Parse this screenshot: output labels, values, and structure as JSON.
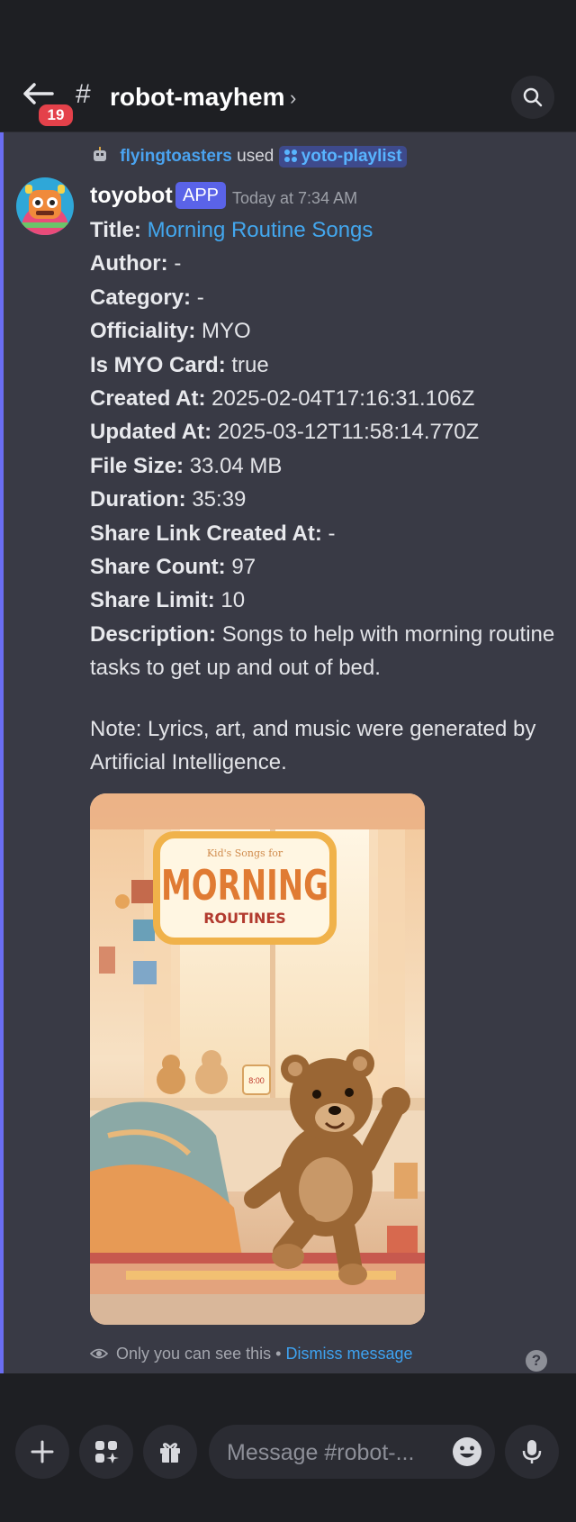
{
  "header": {
    "unread_count": "19",
    "channel_name": "robot-mayhem",
    "hash": "#",
    "chevron": "›"
  },
  "reply": {
    "user": "flyingtoasters",
    "used": "used",
    "command": "yoto-playlist"
  },
  "message": {
    "author": "toyobot",
    "app_tag": "APP",
    "timestamp": "Today at 7:34 AM",
    "fields": [
      {
        "key": "Title:",
        "value": "Morning Routine Songs"
      },
      {
        "key": "Author:",
        "value": "-"
      },
      {
        "key": "Category:",
        "value": "-"
      },
      {
        "key": "Officiality:",
        "value": "MYO"
      },
      {
        "key": "Is MYO Card:",
        "value": "true"
      },
      {
        "key": "Created At:",
        "value": "2025-02-04T17:16:31.106Z"
      },
      {
        "key": "Updated At:",
        "value": "2025-03-12T11:58:14.770Z"
      },
      {
        "key": "File Size:",
        "value": "33.04 MB"
      },
      {
        "key": "Duration:",
        "value": "35:39"
      },
      {
        "key": "Share Link Created At:",
        "value": "-"
      },
      {
        "key": "Share Count:",
        "value": "97"
      },
      {
        "key": "Share Limit:",
        "value": "10"
      },
      {
        "key": "Description:",
        "value": "Songs to help with morning routine tasks to get up and out of bed."
      }
    ],
    "note": "Note: Lyrics, art, and music were generated by Artificial Intelligence.",
    "cover": {
      "small_text": "Kid's Songs for",
      "big_text": "MORNING",
      "sub_text": "ROUTINES",
      "clock": "8:00"
    },
    "ephemeral_text": "Only you can see this",
    "bullet": "•",
    "dismiss": "Dismiss message",
    "help": "?"
  },
  "composer": {
    "placeholder": "Message #robot-..."
  },
  "colors": {
    "accent": "#6a6df2",
    "link": "#43a7ee",
    "badge": "#e4414a",
    "app_tag": "#5a63e8"
  }
}
